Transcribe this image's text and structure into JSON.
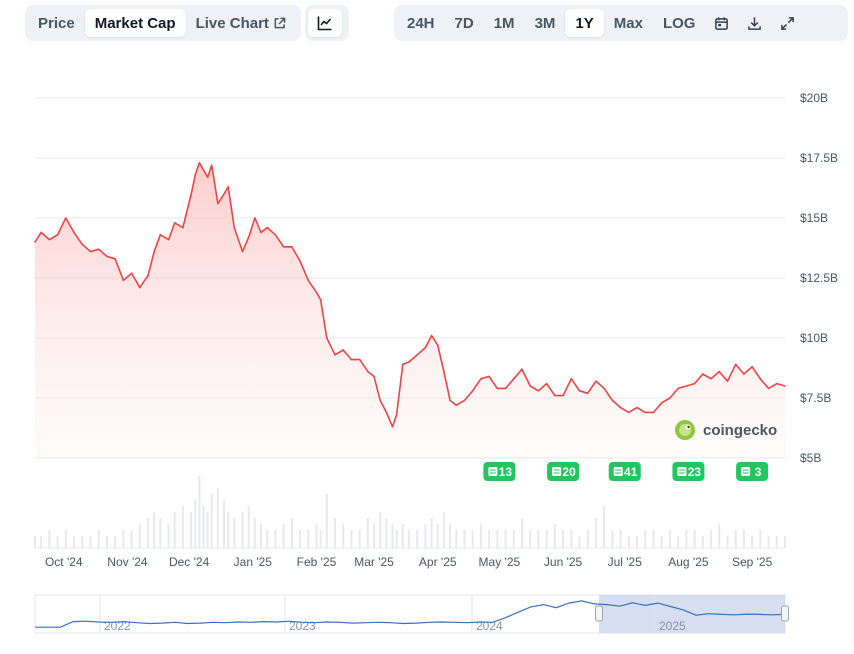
{
  "toolbar": {
    "left_tabs": [
      {
        "label": "Price",
        "active": false
      },
      {
        "label": "Market Cap",
        "active": true
      },
      {
        "label": "Live Chart",
        "active": false,
        "icon": "external-link-icon"
      }
    ],
    "chart_type_icon": "line-chart-icon",
    "ranges": [
      {
        "label": "24H",
        "active": false
      },
      {
        "label": "7D",
        "active": false
      },
      {
        "label": "1M",
        "active": false
      },
      {
        "label": "3M",
        "active": false
      },
      {
        "label": "1Y",
        "active": true
      },
      {
        "label": "Max",
        "active": false
      },
      {
        "label": "LOG",
        "active": false
      }
    ],
    "right_icons": [
      "calendar-icon",
      "download-icon",
      "expand-icon"
    ]
  },
  "watermark": {
    "text": "coingecko",
    "icon": "gecko-logo-icon"
  },
  "events": [
    {
      "month": "May '25",
      "count": "13"
    },
    {
      "month": "Jun '25",
      "count": "20"
    },
    {
      "month": "Jul '25",
      "count": "41"
    },
    {
      "month": "Aug '25",
      "count": "23"
    },
    {
      "month": "Sep '25",
      "count": "3"
    }
  ],
  "colors": {
    "line": "#ef4444",
    "fill": "#fecaca",
    "event": "#22c55e",
    "navigator": "#3b6fc4",
    "selection": "#c7d4ea"
  },
  "chart_data": {
    "type": "area",
    "title": "",
    "xlabel": "",
    "ylabel": "",
    "y_unit": "B",
    "ylim": [
      5,
      20
    ],
    "y_ticks": [
      "$20B",
      "$17.5B",
      "$15B",
      "$12.5B",
      "$10B",
      "$7.5B",
      "$5B"
    ],
    "x_ticks": [
      "Oct '24",
      "Nov '24",
      "Dec '24",
      "Jan '25",
      "Feb '25",
      "Mar '25",
      "Apr '25",
      "May '25",
      "Jun '25",
      "Jul '25",
      "Aug '25",
      "Sep '25"
    ],
    "grid": "horizontal",
    "x": [
      "2024-09-17",
      "2024-09-20",
      "2024-09-24",
      "2024-09-28",
      "2024-10-02",
      "2024-10-06",
      "2024-10-10",
      "2024-10-14",
      "2024-10-18",
      "2024-10-22",
      "2024-10-26",
      "2024-10-30",
      "2024-11-03",
      "2024-11-07",
      "2024-11-11",
      "2024-11-14",
      "2024-11-17",
      "2024-11-21",
      "2024-11-24",
      "2024-11-28",
      "2024-12-02",
      "2024-12-04",
      "2024-12-06",
      "2024-12-08",
      "2024-12-10",
      "2024-12-12",
      "2024-12-15",
      "2024-12-18",
      "2024-12-20",
      "2024-12-23",
      "2024-12-27",
      "2024-12-30",
      "2025-01-02",
      "2025-01-05",
      "2025-01-08",
      "2025-01-12",
      "2025-01-16",
      "2025-01-20",
      "2025-01-24",
      "2025-01-28",
      "2025-02-01",
      "2025-02-03",
      "2025-02-06",
      "2025-02-10",
      "2025-02-14",
      "2025-02-18",
      "2025-02-22",
      "2025-02-26",
      "2025-03-01",
      "2025-03-04",
      "2025-03-07",
      "2025-03-10",
      "2025-03-12",
      "2025-03-15",
      "2025-03-18",
      "2025-03-22",
      "2025-03-26",
      "2025-03-29",
      "2025-04-01",
      "2025-04-04",
      "2025-04-07",
      "2025-04-10",
      "2025-04-14",
      "2025-04-18",
      "2025-04-22",
      "2025-04-26",
      "2025-04-30",
      "2025-05-04",
      "2025-05-08",
      "2025-05-12",
      "2025-05-16",
      "2025-05-20",
      "2025-05-24",
      "2025-05-28",
      "2025-06-01",
      "2025-06-05",
      "2025-06-09",
      "2025-06-13",
      "2025-06-17",
      "2025-06-21",
      "2025-06-25",
      "2025-06-29",
      "2025-07-03",
      "2025-07-07",
      "2025-07-11",
      "2025-07-15",
      "2025-07-19",
      "2025-07-23",
      "2025-07-27",
      "2025-07-31",
      "2025-08-04",
      "2025-08-08",
      "2025-08-12",
      "2025-08-16",
      "2025-08-20",
      "2025-08-24",
      "2025-08-28",
      "2025-09-01",
      "2025-09-05",
      "2025-09-09",
      "2025-09-13",
      "2025-09-17"
    ],
    "values": [
      14.0,
      14.4,
      14.1,
      14.3,
      15.0,
      14.4,
      13.9,
      13.6,
      13.7,
      13.4,
      13.3,
      12.4,
      12.7,
      12.1,
      12.6,
      13.6,
      14.3,
      14.1,
      14.8,
      14.6,
      16.0,
      16.8,
      17.3,
      17.0,
      16.7,
      17.2,
      15.6,
      16.0,
      16.3,
      14.6,
      13.6,
      14.2,
      15.0,
      14.4,
      14.6,
      14.3,
      13.8,
      13.8,
      13.2,
      12.4,
      11.9,
      11.6,
      10.0,
      9.3,
      9.5,
      9.1,
      9.1,
      8.6,
      8.4,
      7.4,
      6.9,
      6.3,
      6.8,
      8.9,
      9.0,
      9.3,
      9.6,
      10.1,
      9.7,
      8.6,
      7.4,
      7.2,
      7.4,
      7.8,
      8.3,
      8.4,
      7.9,
      7.9,
      8.3,
      8.7,
      8.0,
      7.8,
      8.1,
      7.6,
      7.6,
      8.3,
      7.8,
      7.7,
      8.2,
      7.9,
      7.4,
      7.1,
      6.9,
      7.1,
      6.9,
      6.9,
      7.3,
      7.5,
      7.9,
      8.0,
      8.1,
      8.5,
      8.3,
      8.6,
      8.2,
      8.9,
      8.5,
      8.8,
      8.3,
      7.9,
      8.1,
      8.0
    ],
    "volume_index": [
      2,
      2,
      3,
      2,
      3,
      2,
      2,
      2,
      3,
      2,
      2,
      3,
      3,
      4,
      5,
      6,
      5,
      4,
      6,
      7,
      6,
      8,
      12,
      7,
      6,
      9,
      10,
      8,
      6,
      5,
      6,
      7,
      5,
      4,
      3,
      3,
      4,
      5,
      3,
      3,
      4,
      3,
      9,
      5,
      4,
      3,
      3,
      5,
      4,
      6,
      5,
      4,
      3,
      4,
      3,
      3,
      4,
      5,
      4,
      6,
      4,
      3,
      3,
      3,
      4,
      3,
      3,
      3,
      3,
      5,
      3,
      3,
      3,
      4,
      3,
      3,
      2,
      3,
      5,
      7,
      3,
      3,
      2,
      2,
      3,
      3,
      2,
      3,
      2,
      3,
      3,
      2,
      3,
      4,
      2,
      3,
      3,
      2,
      3,
      2,
      2,
      2
    ],
    "navigator": {
      "x_ticks": [
        "2022",
        "2023",
        "2024",
        "2025"
      ],
      "values": [
        1.0,
        1.0,
        1.0,
        2.5,
        2.6,
        2.4,
        2.3,
        2.5,
        2.2,
        2.0,
        2.1,
        2.3,
        2.0,
        2.1,
        2.3,
        2.2,
        2.4,
        2.3,
        2.5,
        2.4,
        2.6,
        2.3,
        2.2,
        2.4,
        2.3,
        2.1,
        2.2,
        2.3,
        2.2,
        2.0,
        2.1,
        2.3,
        2.4,
        2.3,
        2.2,
        2.4,
        2.3,
        3.5,
        5.0,
        6.4,
        7.0,
        6.2,
        7.4,
        8.0,
        7.2,
        7.0,
        6.6,
        7.5,
        6.8,
        7.4,
        6.5,
        5.6,
        4.2,
        4.6,
        4.4,
        4.3,
        4.5,
        4.4,
        4.3,
        4.4
      ],
      "selection": [
        "2024-09-17",
        "2025-09-17"
      ]
    }
  }
}
